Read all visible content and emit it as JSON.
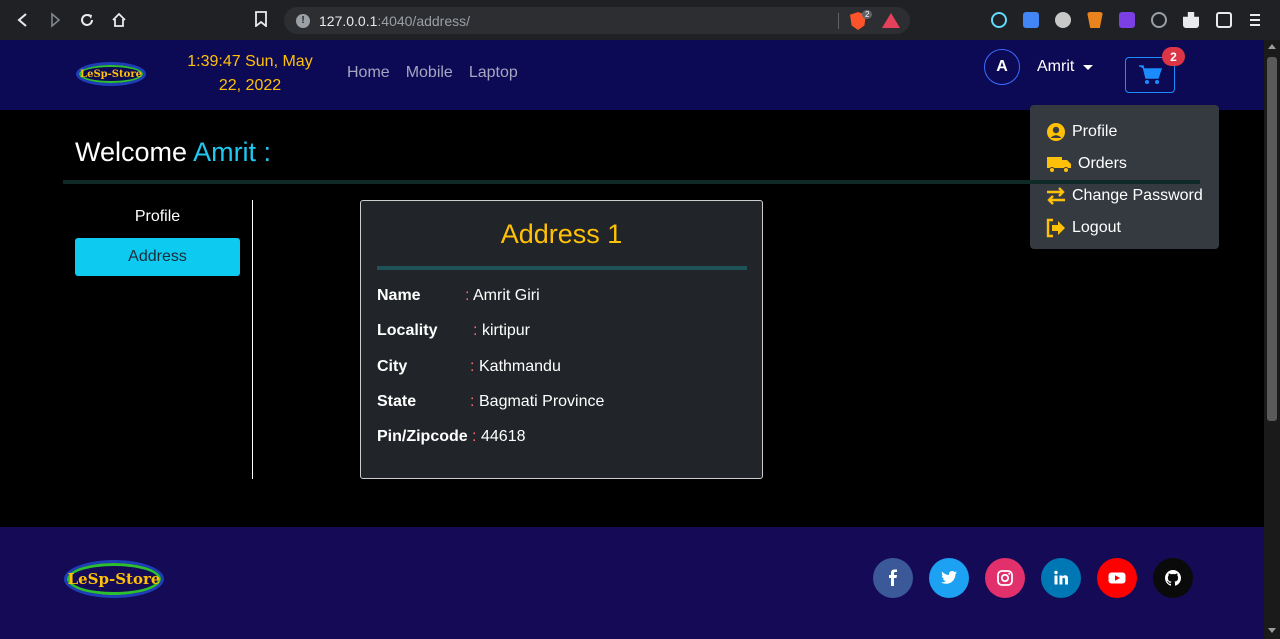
{
  "browser": {
    "url_host": "127.0.0.1",
    "url_rest": ":4040/address/",
    "brave_count": "2"
  },
  "navbar": {
    "logo": "LeSp-Store",
    "clock": "1:39:47 Sun, May 22, 2022",
    "links": [
      "Home",
      "Mobile",
      "Laptop"
    ],
    "avatar_initial": "A",
    "user_name": "Amrit",
    "cart_count": "2"
  },
  "dropdown": {
    "items": [
      "Profile",
      "Orders",
      "Change Password",
      "Logout"
    ]
  },
  "welcome": {
    "greeting": "Welcome",
    "name": "Amrit :"
  },
  "sidebar": {
    "items": [
      "Profile",
      "Address"
    ]
  },
  "address_card": {
    "title": "Address 1",
    "rows": [
      {
        "label": "Name",
        "value": "Amrit Giri"
      },
      {
        "label": "Locality",
        "value": "kirtipur"
      },
      {
        "label": "City",
        "value": "Kathmandu"
      },
      {
        "label": "State",
        "value": "Bagmati Province"
      },
      {
        "label": "Pin/Zipcode",
        "value": "44618"
      }
    ]
  },
  "footer": {
    "logo": "LeSp-Store",
    "social": [
      "facebook-icon",
      "twitter-icon",
      "instagram-icon",
      "linkedin-icon",
      "youtube-icon",
      "github-icon"
    ]
  },
  "colors": {
    "accent": "#ffc107",
    "info": "#0dcaf0",
    "navbar": "#0d0a55",
    "footer": "#140a55"
  }
}
